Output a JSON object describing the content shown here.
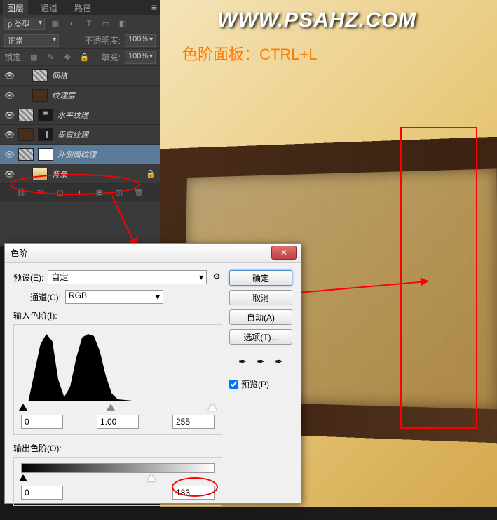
{
  "watermark": "WWW.PSAHZ.COM",
  "hint": "色阶面板：CTRL+L",
  "panel": {
    "tabs": {
      "layers": "图层",
      "channels": "通道",
      "paths": "路径"
    },
    "filter_label": "ρ 类型",
    "blend_mode": "正常",
    "opacity_label": "不透明度:",
    "opacity_value": "100%",
    "lock_label": "锁定:",
    "fill_label": "填充:",
    "fill_value": "100%",
    "layers": [
      {
        "name": "网格"
      },
      {
        "name": "纹理层"
      },
      {
        "name": "水平纹理"
      },
      {
        "name": "垂直纹理"
      },
      {
        "name": "外侧面纹理"
      },
      {
        "name": "背景"
      }
    ]
  },
  "dialog": {
    "title": "色阶",
    "preset_label": "预设(E):",
    "preset_value": "自定",
    "channel_label": "通道(C):",
    "channel_value": "RGB",
    "input_label": "输入色阶(I):",
    "output_label": "输出色阶(O):",
    "in_black": "0",
    "in_gamma": "1.00",
    "in_white": "255",
    "out_black": "0",
    "out_white": "183",
    "ok": "确定",
    "cancel": "取消",
    "auto": "自动(A)",
    "options": "选项(T)...",
    "preview": "预览(P)"
  }
}
